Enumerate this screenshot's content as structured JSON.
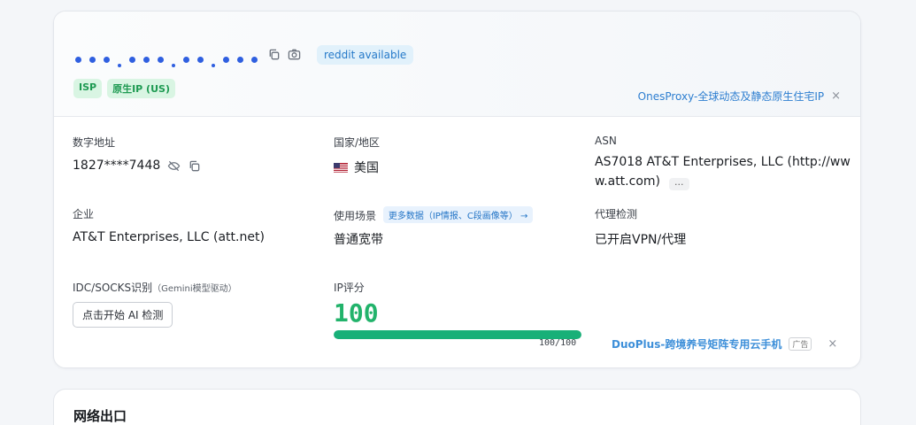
{
  "ip": {
    "masked_groups": [
      3,
      3,
      2,
      3
    ],
    "copy_icon": "copy-icon",
    "screenshot_icon": "camera-icon",
    "reddit_badge": "reddit available"
  },
  "tags": [
    "ISP",
    "原生IP (US)"
  ],
  "promo_top": {
    "text": "OnesProxy-全球动态及静态原生住宅IP",
    "close": "×"
  },
  "fields": {
    "numeric_address": {
      "label": "数字地址",
      "value": "1827****7448"
    },
    "country": {
      "label": "国家/地区",
      "value": "美国",
      "flag": "us-flag"
    },
    "asn": {
      "label": "ASN",
      "value_line1": "AS7018 AT&T Enterprises, LLC (http://ww",
      "value_line2": "w.att.com)",
      "more": "..."
    },
    "company": {
      "label": "企业",
      "value": "AT&T Enterprises, LLC (att.net)"
    },
    "usage": {
      "label": "使用场景",
      "link": "更多数据（IP情报、C段画像等） →",
      "value": "普通宽带"
    },
    "proxy": {
      "label": "代理检测",
      "value": "已开启VPN/代理"
    },
    "idc": {
      "label": "IDC/SOCKS识别",
      "note": "（Gemini模型驱动）",
      "button": "点击开始 AI 检测"
    },
    "score": {
      "label": "IP评分",
      "value": "100",
      "bar_text": "100/100",
      "fraction": 1.0
    }
  },
  "promo_bottom": {
    "text": "DuoPlus-跨境养号矩阵专用云手机",
    "ad": "广告",
    "close": "×"
  },
  "section2": {
    "title": "网络出口"
  },
  "colors": {
    "accent_blue": "#2f5fe0",
    "score_green": "#18b078"
  }
}
